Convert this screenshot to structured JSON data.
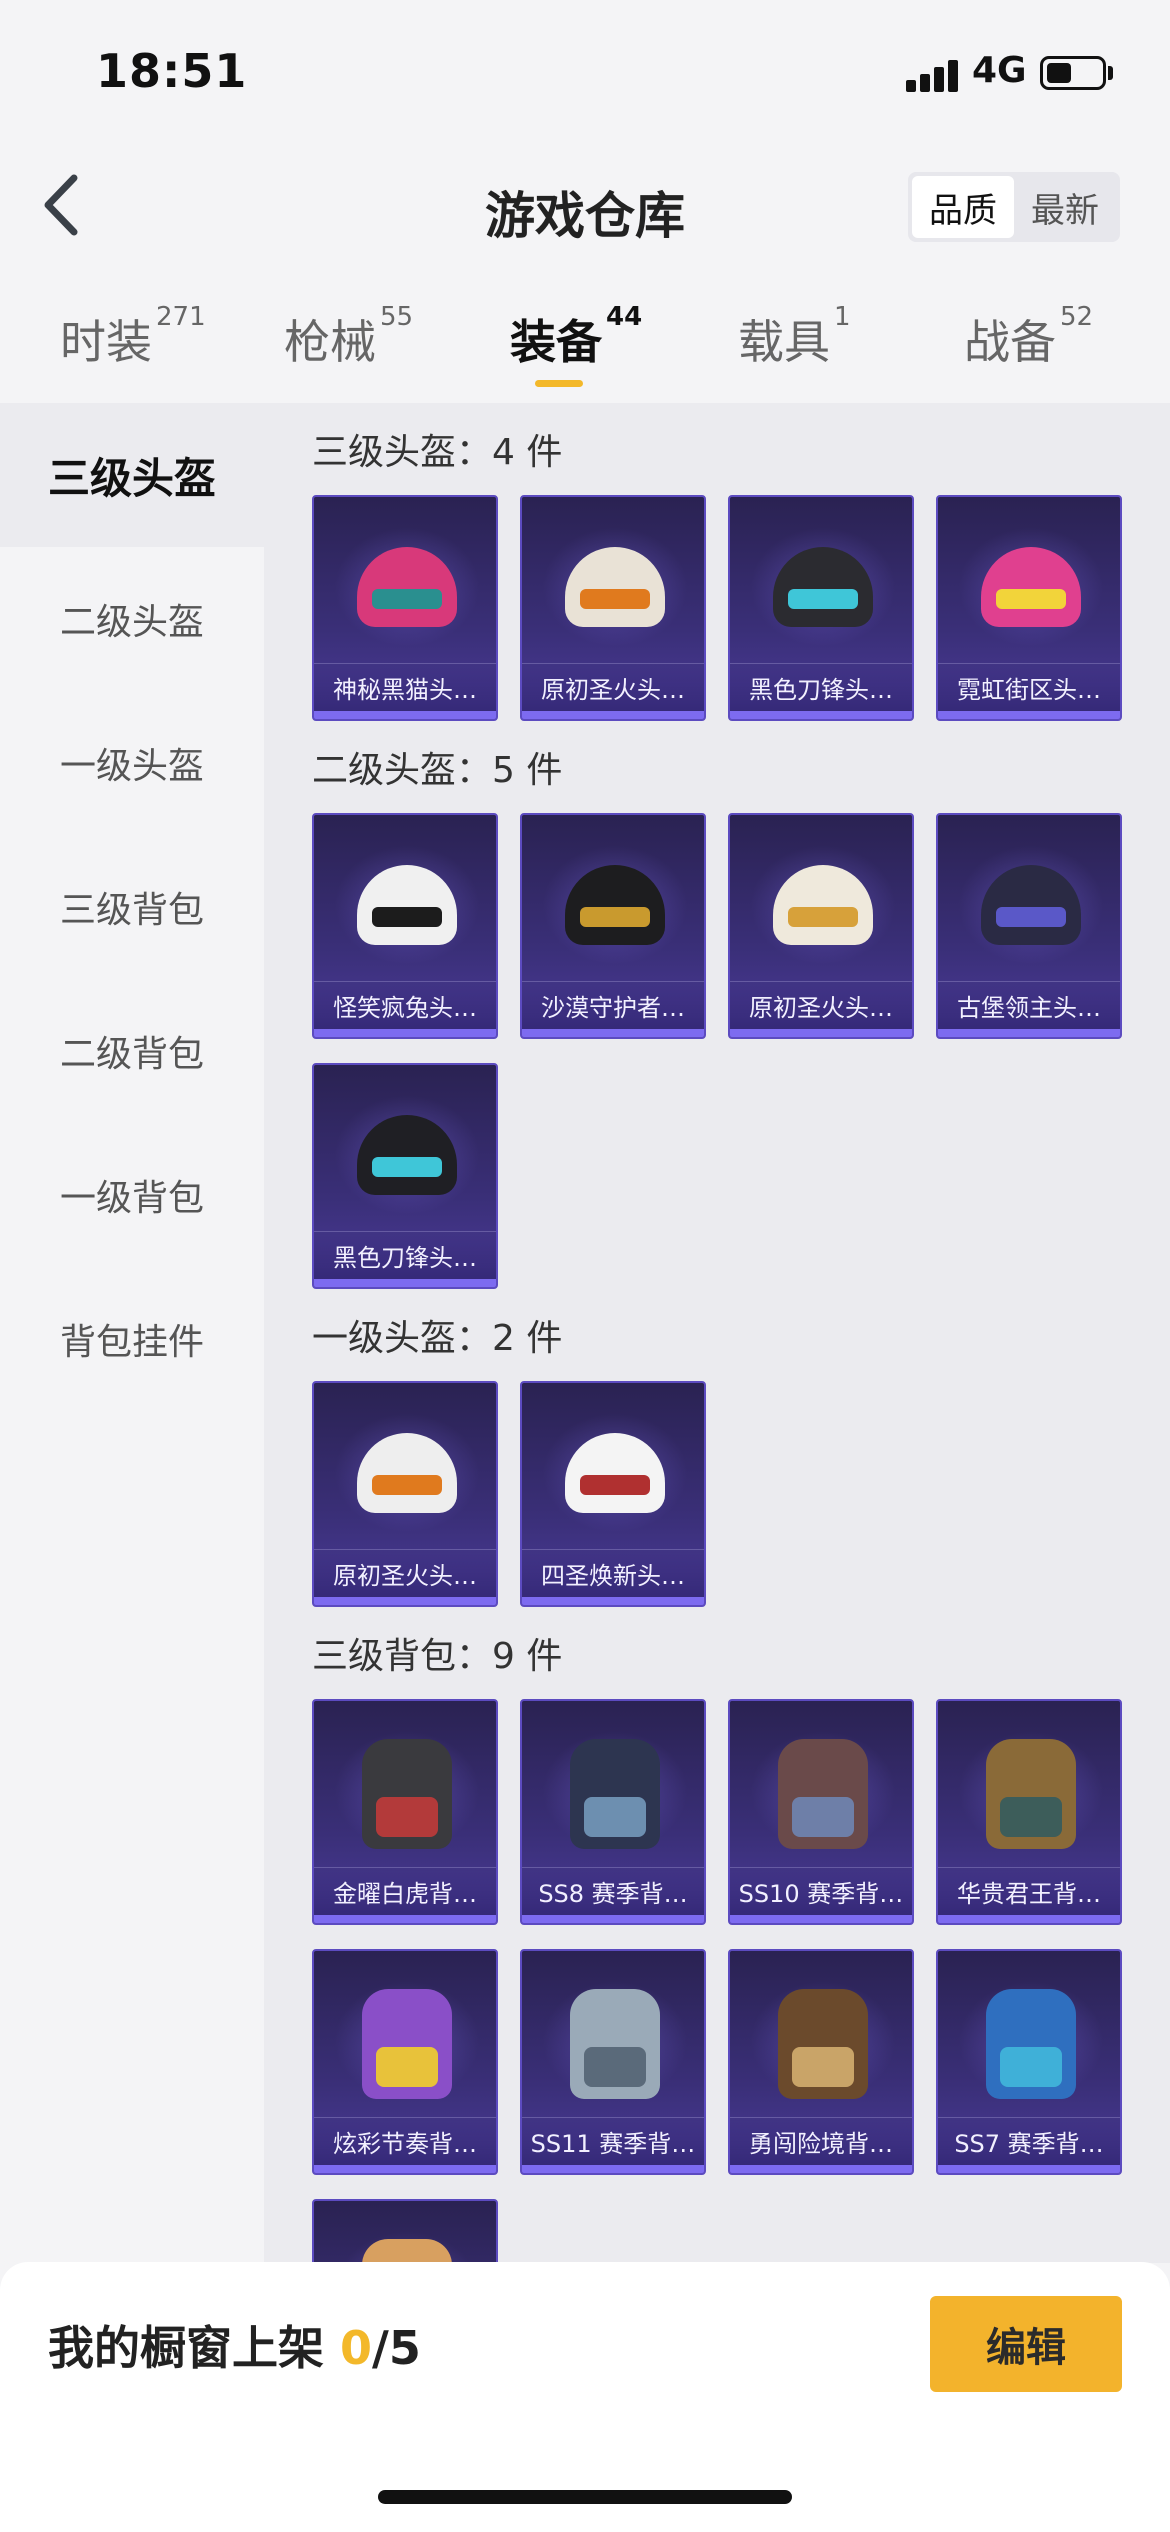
{
  "status": {
    "time": "18:51",
    "network": "4G"
  },
  "header": {
    "title": "游戏仓库",
    "sort_options": [
      "品质",
      "最新"
    ],
    "sort_selected": "品质"
  },
  "tabs": [
    {
      "label": "时装",
      "count": "271"
    },
    {
      "label": "枪械",
      "count": "55"
    },
    {
      "label": "装备",
      "count": "44"
    },
    {
      "label": "载具",
      "count": "1"
    },
    {
      "label": "战备",
      "count": "52"
    }
  ],
  "sidebar": {
    "items": [
      "三级头盔",
      "二级头盔",
      "一级头盔",
      "三级背包",
      "二级背包",
      "一级背包",
      "背包挂件"
    ],
    "active": "三级头盔"
  },
  "sections": [
    {
      "title": "三级头盔：4 件",
      "items": [
        "神秘黑猫头…",
        "原初圣火头…",
        "黑色刀锋头…",
        "霓虹街区头…"
      ]
    },
    {
      "title": "二级头盔：5 件",
      "items": [
        "怪笑疯兔头…",
        "沙漠守护者…",
        "原初圣火头…",
        "古堡领主头…",
        "黑色刀锋头…"
      ]
    },
    {
      "title": "一级头盔：2 件",
      "items": [
        "原初圣火头…",
        "四圣焕新头…"
      ]
    },
    {
      "title": "三级背包：9 件",
      "items": [
        "金曜白虎背…",
        "SS8 赛季背…",
        "SS10 赛季背…",
        "华贵君王背…",
        "炫彩节奏背…",
        "SS11 赛季背…",
        "勇闯险境背…",
        "SS7 赛季背…"
      ]
    }
  ],
  "footer": {
    "shelf_label": "我的橱窗上架 ",
    "shelf_current": "0",
    "shelf_total": "/5",
    "edit_label": "编辑"
  },
  "colors": {
    "accent": "#f3b82a",
    "card_bg": "#3a2f78",
    "card_bar": "#7d6bf0"
  }
}
